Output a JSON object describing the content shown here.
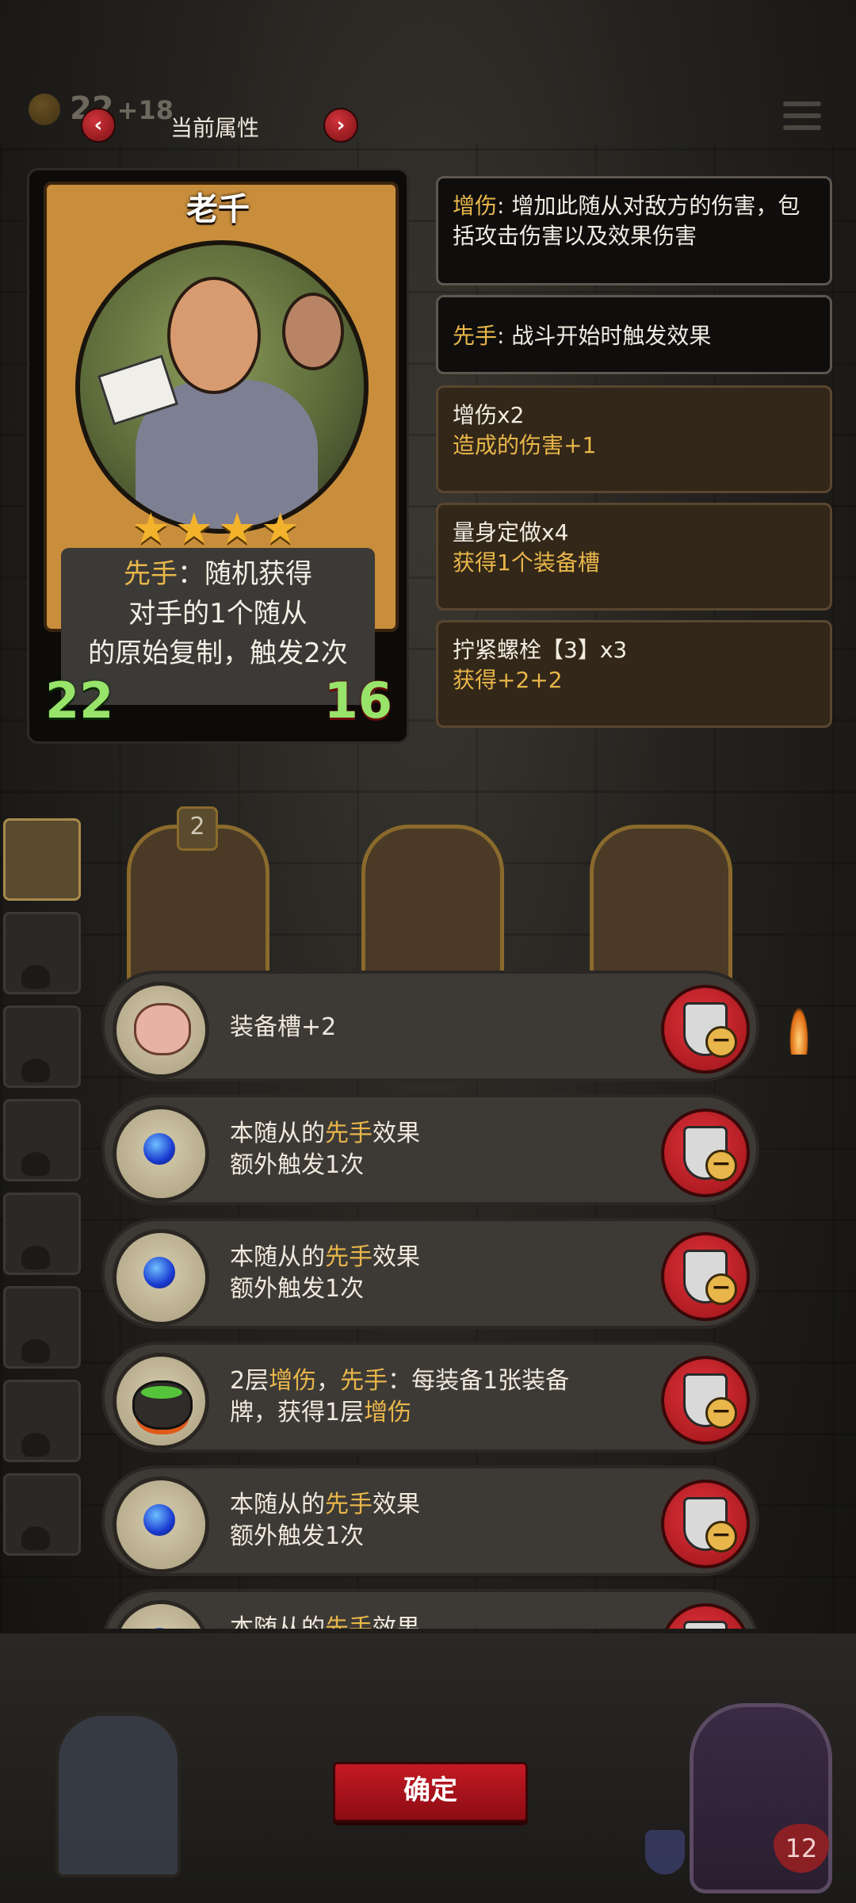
{
  "topbar": {
    "gold": "22",
    "gold_bonus": "+18",
    "prev_arrow": "‹",
    "next_arrow": "›",
    "title": "当前属性"
  },
  "card": {
    "name": "老千",
    "stars": "★★★★",
    "star_count": 4,
    "desc_key": "先手",
    "desc_line1_rest": "：随机获得",
    "desc_line2": "对手的1个随从",
    "desc_line3": "的原始复制，触发2次",
    "attack": "22",
    "health": "16"
  },
  "info_panels": [
    {
      "key": "增伤",
      "text": ": 增加此随从对敌方的伤害，包括攻击伤害以及效果伤害"
    },
    {
      "key": "先手",
      "text": ": 战斗开始时触发效果"
    }
  ],
  "buffs": [
    {
      "title": "增伤x2",
      "effect": "造成的伤害+1"
    },
    {
      "title": "量身定做x4",
      "effect": "获得1个装备槽"
    },
    {
      "title": "拧紧螺栓【3】x3",
      "effect": "获得+2+2"
    }
  ],
  "board": {
    "minion_level": "2"
  },
  "equipment": [
    {
      "icon": "pig-icon",
      "line1": "装备槽+2"
    },
    {
      "icon": "blue-orb-icon",
      "line1_pre": "本随从的",
      "line1_key": "先手",
      "line1_post": "效果",
      "line2": "额外触发1次"
    },
    {
      "icon": "blue-orb-icon",
      "line1_pre": "本随从的",
      "line1_key": "先手",
      "line1_post": "效果",
      "line2": "额外触发1次"
    },
    {
      "icon": "cauldron-icon",
      "p1": "2层",
      "k1": "增伤",
      "p2": "，",
      "k2": "先手",
      "p3": "：每装备1张装备",
      "line2_pre": "牌，获得1层",
      "line2_key": "增伤"
    },
    {
      "icon": "blue-orb-icon",
      "line1_pre": "本随从的",
      "line1_key": "先手",
      "line1_post": "效果",
      "line2": "额外触发1次"
    },
    {
      "icon": "blue-orb-icon",
      "line1_pre": "本随从的",
      "line1_key": "先手",
      "line1_post": "效果"
    }
  ],
  "confirm_label": "确定",
  "hero": {
    "health": "12"
  },
  "colors": {
    "accent_gold": "#e8b64a",
    "stat_green": "#98e46a",
    "button_red": "#c41a24"
  }
}
